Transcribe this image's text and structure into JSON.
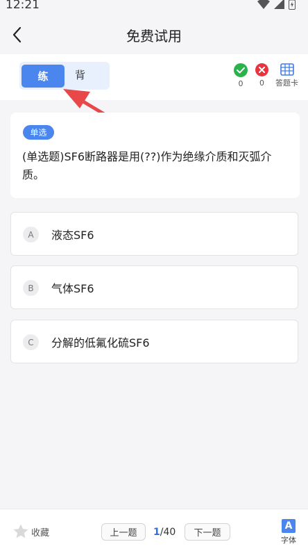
{
  "status_bar": {
    "time": "12:21"
  },
  "header": {
    "title": "免费试用"
  },
  "mode": {
    "practice_label": "练",
    "recite_label": "背"
  },
  "stats": {
    "correct_count": "0",
    "wrong_count": "0",
    "answer_card_label": "答题卡"
  },
  "question": {
    "type_badge": "单选",
    "text": "(单选题)SF6断路器是用(??)作为绝缘介质和灭弧介质。",
    "options": [
      {
        "letter": "A",
        "text": "液态SF6"
      },
      {
        "letter": "B",
        "text": "气体SF6"
      },
      {
        "letter": "C",
        "text": "分解的低氟化硫SF6"
      }
    ]
  },
  "bottom": {
    "favorite_label": "收藏",
    "prev_label": "上一题",
    "next_label": "下一题",
    "current_page": "1",
    "total_pages": "/40",
    "font_icon_letter": "A",
    "font_label": "字体"
  },
  "colors": {
    "accent": "#4a86ee",
    "correct": "#2ab24b",
    "wrong": "#e8343f",
    "annotation_arrow": "#e8484a"
  }
}
